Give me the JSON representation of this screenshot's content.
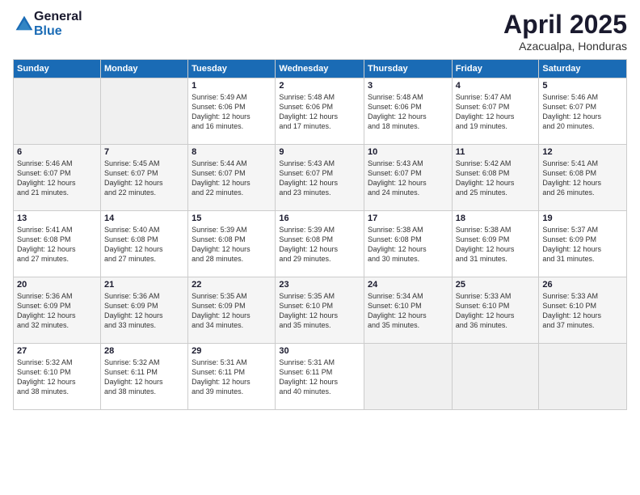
{
  "logo": {
    "general": "General",
    "blue": "Blue"
  },
  "title": "April 2025",
  "subtitle": "Azacualpa, Honduras",
  "weekdays": [
    "Sunday",
    "Monday",
    "Tuesday",
    "Wednesday",
    "Thursday",
    "Friday",
    "Saturday"
  ],
  "weeks": [
    [
      {
        "day": "",
        "info": ""
      },
      {
        "day": "",
        "info": ""
      },
      {
        "day": "1",
        "info": "Sunrise: 5:49 AM\nSunset: 6:06 PM\nDaylight: 12 hours\nand 16 minutes."
      },
      {
        "day": "2",
        "info": "Sunrise: 5:48 AM\nSunset: 6:06 PM\nDaylight: 12 hours\nand 17 minutes."
      },
      {
        "day": "3",
        "info": "Sunrise: 5:48 AM\nSunset: 6:06 PM\nDaylight: 12 hours\nand 18 minutes."
      },
      {
        "day": "4",
        "info": "Sunrise: 5:47 AM\nSunset: 6:07 PM\nDaylight: 12 hours\nand 19 minutes."
      },
      {
        "day": "5",
        "info": "Sunrise: 5:46 AM\nSunset: 6:07 PM\nDaylight: 12 hours\nand 20 minutes."
      }
    ],
    [
      {
        "day": "6",
        "info": "Sunrise: 5:46 AM\nSunset: 6:07 PM\nDaylight: 12 hours\nand 21 minutes."
      },
      {
        "day": "7",
        "info": "Sunrise: 5:45 AM\nSunset: 6:07 PM\nDaylight: 12 hours\nand 22 minutes."
      },
      {
        "day": "8",
        "info": "Sunrise: 5:44 AM\nSunset: 6:07 PM\nDaylight: 12 hours\nand 22 minutes."
      },
      {
        "day": "9",
        "info": "Sunrise: 5:43 AM\nSunset: 6:07 PM\nDaylight: 12 hours\nand 23 minutes."
      },
      {
        "day": "10",
        "info": "Sunrise: 5:43 AM\nSunset: 6:07 PM\nDaylight: 12 hours\nand 24 minutes."
      },
      {
        "day": "11",
        "info": "Sunrise: 5:42 AM\nSunset: 6:08 PM\nDaylight: 12 hours\nand 25 minutes."
      },
      {
        "day": "12",
        "info": "Sunrise: 5:41 AM\nSunset: 6:08 PM\nDaylight: 12 hours\nand 26 minutes."
      }
    ],
    [
      {
        "day": "13",
        "info": "Sunrise: 5:41 AM\nSunset: 6:08 PM\nDaylight: 12 hours\nand 27 minutes."
      },
      {
        "day": "14",
        "info": "Sunrise: 5:40 AM\nSunset: 6:08 PM\nDaylight: 12 hours\nand 27 minutes."
      },
      {
        "day": "15",
        "info": "Sunrise: 5:39 AM\nSunset: 6:08 PM\nDaylight: 12 hours\nand 28 minutes."
      },
      {
        "day": "16",
        "info": "Sunrise: 5:39 AM\nSunset: 6:08 PM\nDaylight: 12 hours\nand 29 minutes."
      },
      {
        "day": "17",
        "info": "Sunrise: 5:38 AM\nSunset: 6:08 PM\nDaylight: 12 hours\nand 30 minutes."
      },
      {
        "day": "18",
        "info": "Sunrise: 5:38 AM\nSunset: 6:09 PM\nDaylight: 12 hours\nand 31 minutes."
      },
      {
        "day": "19",
        "info": "Sunrise: 5:37 AM\nSunset: 6:09 PM\nDaylight: 12 hours\nand 31 minutes."
      }
    ],
    [
      {
        "day": "20",
        "info": "Sunrise: 5:36 AM\nSunset: 6:09 PM\nDaylight: 12 hours\nand 32 minutes."
      },
      {
        "day": "21",
        "info": "Sunrise: 5:36 AM\nSunset: 6:09 PM\nDaylight: 12 hours\nand 33 minutes."
      },
      {
        "day": "22",
        "info": "Sunrise: 5:35 AM\nSunset: 6:09 PM\nDaylight: 12 hours\nand 34 minutes."
      },
      {
        "day": "23",
        "info": "Sunrise: 5:35 AM\nSunset: 6:10 PM\nDaylight: 12 hours\nand 35 minutes."
      },
      {
        "day": "24",
        "info": "Sunrise: 5:34 AM\nSunset: 6:10 PM\nDaylight: 12 hours\nand 35 minutes."
      },
      {
        "day": "25",
        "info": "Sunrise: 5:33 AM\nSunset: 6:10 PM\nDaylight: 12 hours\nand 36 minutes."
      },
      {
        "day": "26",
        "info": "Sunrise: 5:33 AM\nSunset: 6:10 PM\nDaylight: 12 hours\nand 37 minutes."
      }
    ],
    [
      {
        "day": "27",
        "info": "Sunrise: 5:32 AM\nSunset: 6:10 PM\nDaylight: 12 hours\nand 38 minutes."
      },
      {
        "day": "28",
        "info": "Sunrise: 5:32 AM\nSunset: 6:11 PM\nDaylight: 12 hours\nand 38 minutes."
      },
      {
        "day": "29",
        "info": "Sunrise: 5:31 AM\nSunset: 6:11 PM\nDaylight: 12 hours\nand 39 minutes."
      },
      {
        "day": "30",
        "info": "Sunrise: 5:31 AM\nSunset: 6:11 PM\nDaylight: 12 hours\nand 40 minutes."
      },
      {
        "day": "",
        "info": ""
      },
      {
        "day": "",
        "info": ""
      },
      {
        "day": "",
        "info": ""
      }
    ]
  ]
}
